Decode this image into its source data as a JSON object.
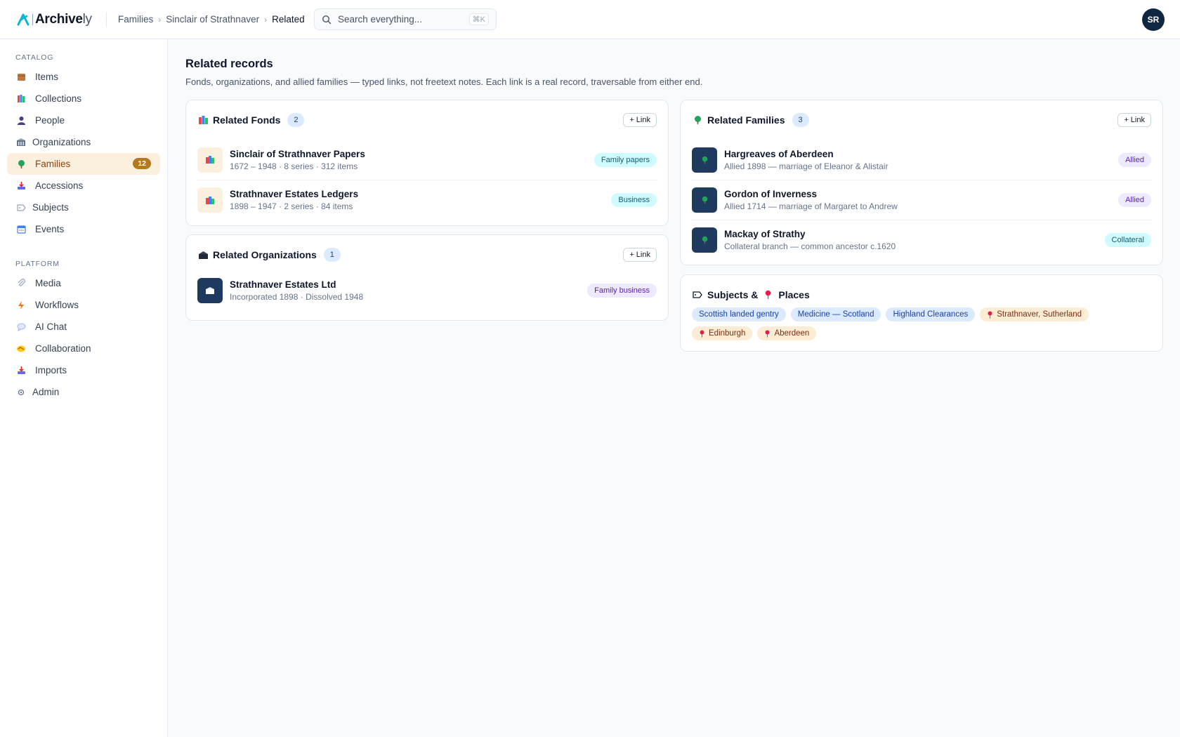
{
  "app": {
    "name_main": "Archive",
    "name_suffix": "ly",
    "user_initials": "SR"
  },
  "breadcrumb": [
    "Families",
    "Sinclair of Strathnaver",
    "Related"
  ],
  "search": {
    "placeholder": "Search everything...",
    "shortcut": "⌘K"
  },
  "sidebar": {
    "catalog_label": "CATALOG",
    "platform_label": "PLATFORM",
    "catalog": [
      {
        "label": "Items",
        "icon": "package-icon"
      },
      {
        "label": "Collections",
        "icon": "books-icon"
      },
      {
        "label": "People",
        "icon": "person-icon"
      },
      {
        "label": "Organizations",
        "icon": "building-icon"
      },
      {
        "label": "Families",
        "icon": "tree-icon",
        "count": "12",
        "active": true
      },
      {
        "label": "Accessions",
        "icon": "inbox-tray-icon"
      },
      {
        "label": "Subjects",
        "icon": "tag-icon"
      },
      {
        "label": "Events",
        "icon": "calendar-icon"
      }
    ],
    "platform": [
      {
        "label": "Media",
        "icon": "paperclip-icon"
      },
      {
        "label": "Workflows",
        "icon": "lightning-icon"
      },
      {
        "label": "AI Chat",
        "icon": "chat-bubble-icon"
      },
      {
        "label": "Collaboration",
        "icon": "handshake-icon"
      },
      {
        "label": "Imports",
        "icon": "inbox-tray-icon"
      },
      {
        "label": "Admin",
        "icon": "gear-icon"
      }
    ]
  },
  "page": {
    "title": "Related records",
    "subtitle": "Fonds, organizations, and allied families — typed links, not freetext notes. Each link is a real record, traversable from either end."
  },
  "fonds": {
    "title": "Related Fonds",
    "count": "2",
    "link_label": "+ Link",
    "items": [
      {
        "title": "Sinclair of Strathnaver Papers",
        "meta": "1672 – 1948 · 8 series · 312 items",
        "tag": "Family papers"
      },
      {
        "title": "Strathnaver Estates Ledgers",
        "meta": "1898 – 1947 · 2 series · 84 items",
        "tag": "Business"
      }
    ]
  },
  "organizations": {
    "title": "Related Organizations",
    "count": "1",
    "link_label": "+ Link",
    "items": [
      {
        "title": "Strathnaver Estates Ltd",
        "meta": "Incorporated 1898 · Dissolved 1948",
        "tag": "Family business"
      }
    ]
  },
  "families": {
    "title": "Related Families",
    "count": "3",
    "link_label": "+ Link",
    "items": [
      {
        "title": "Hargreaves of Aberdeen",
        "meta": "Allied 1898 — marriage of Eleanor & Alistair",
        "tag": "Allied"
      },
      {
        "title": "Gordon of Inverness",
        "meta": "Allied 1714 — marriage of Margaret to Andrew",
        "tag": "Allied"
      },
      {
        "title": "Mackay of Strathy",
        "meta": "Collateral branch — common ancestor c.1620",
        "tag": "Collateral"
      }
    ]
  },
  "subjects_places": {
    "title_a": "Subjects &",
    "title_b": "Places",
    "subjects": [
      "Scottish landed gentry",
      "Medicine — Scotland",
      "Highland Clearances"
    ],
    "places": [
      "Strathnaver, Sutherland",
      "Edinburgh",
      "Aberdeen"
    ]
  },
  "colors": {
    "brand_teal": "#06b6d4",
    "active_amber": "#b4791e",
    "navy": "#1e3a5f"
  }
}
